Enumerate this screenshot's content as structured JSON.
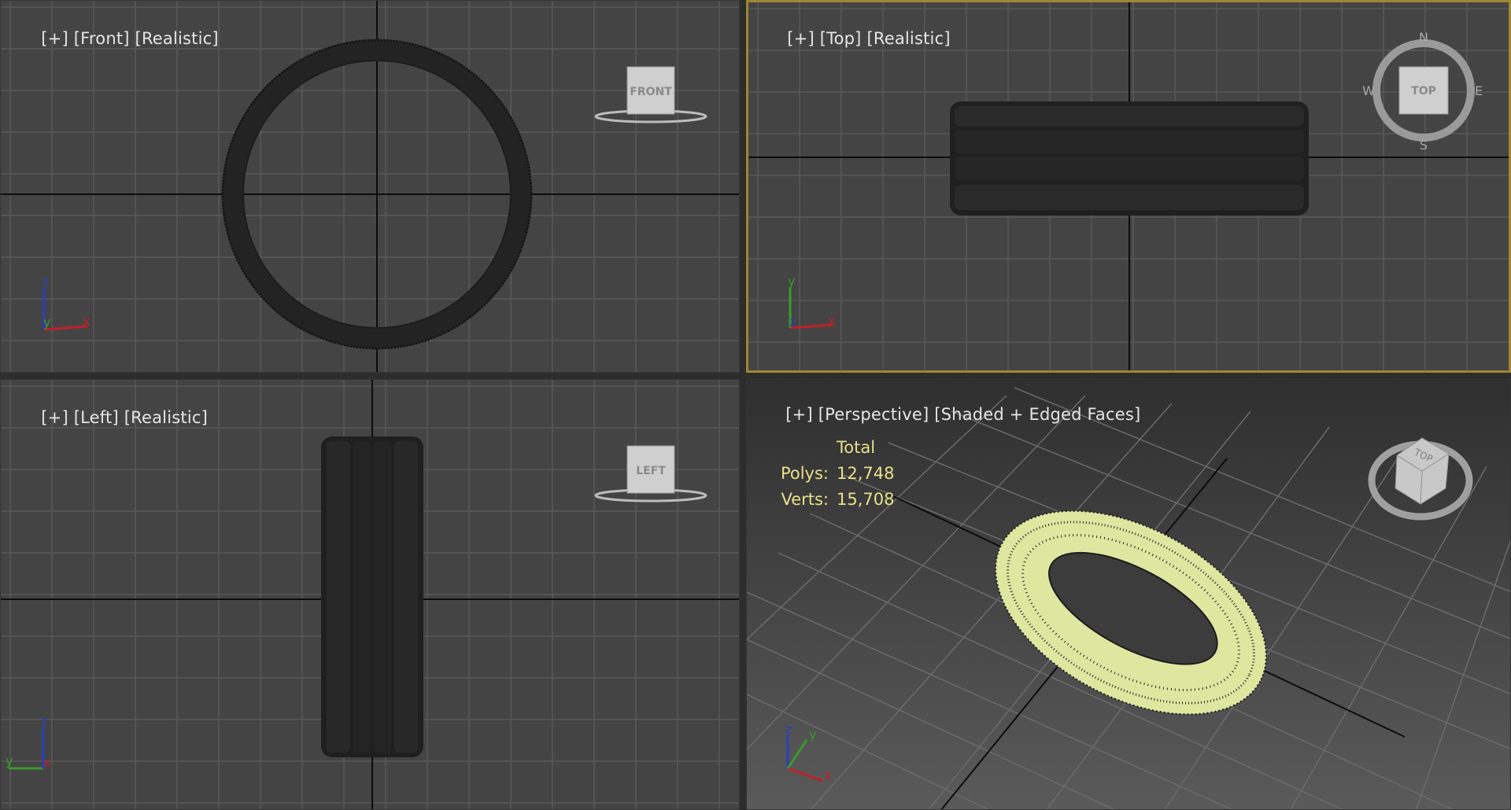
{
  "colors": {
    "viewport_bg": "#444444",
    "grid_line": "#585858",
    "axis_line": "#0c0c0c",
    "active_border": "#9e8634",
    "label_text": "#e6e6e6",
    "stats_text": "#e8e08a",
    "wire": "#e6efaa",
    "axis_x": "#c0202a",
    "axis_y": "#3a9a2a",
    "axis_z": "#2a3fbf"
  },
  "viewports": {
    "front": {
      "label_plus": "[+]",
      "label_view": "[Front]",
      "label_shading": "[Realistic]",
      "viewcube_label": "FRONT",
      "axis_labels": {
        "up": "z",
        "right": "x",
        "origin": "y"
      },
      "active": false
    },
    "top": {
      "label_plus": "[+]",
      "label_view": "[Top]",
      "label_shading": "[Realistic]",
      "viewcube_label": "TOP",
      "compass": {
        "n": "N",
        "s": "S",
        "e": "E",
        "w": "W"
      },
      "axis_labels": {
        "up": "y",
        "right": "x",
        "origin": "z"
      },
      "active": true
    },
    "left": {
      "label_plus": "[+]",
      "label_view": "[Left]",
      "label_shading": "[Realistic]",
      "viewcube_label": "LEFT",
      "axis_labels": {
        "up": "z",
        "right": "x",
        "origin": "y"
      },
      "active": false
    },
    "perspective": {
      "label_plus": "[+]",
      "label_view": "[Perspective]",
      "label_shading": "[Shaded + Edged Faces]",
      "viewcube_label": "TOP",
      "axis_labels": {
        "z": "z",
        "y": "y",
        "x": "x"
      },
      "active": false,
      "stats": {
        "header": "Total",
        "polys_label": "Polys:",
        "polys_value": "12,748",
        "verts_label": "Verts:",
        "verts_value": "15,708"
      }
    }
  }
}
